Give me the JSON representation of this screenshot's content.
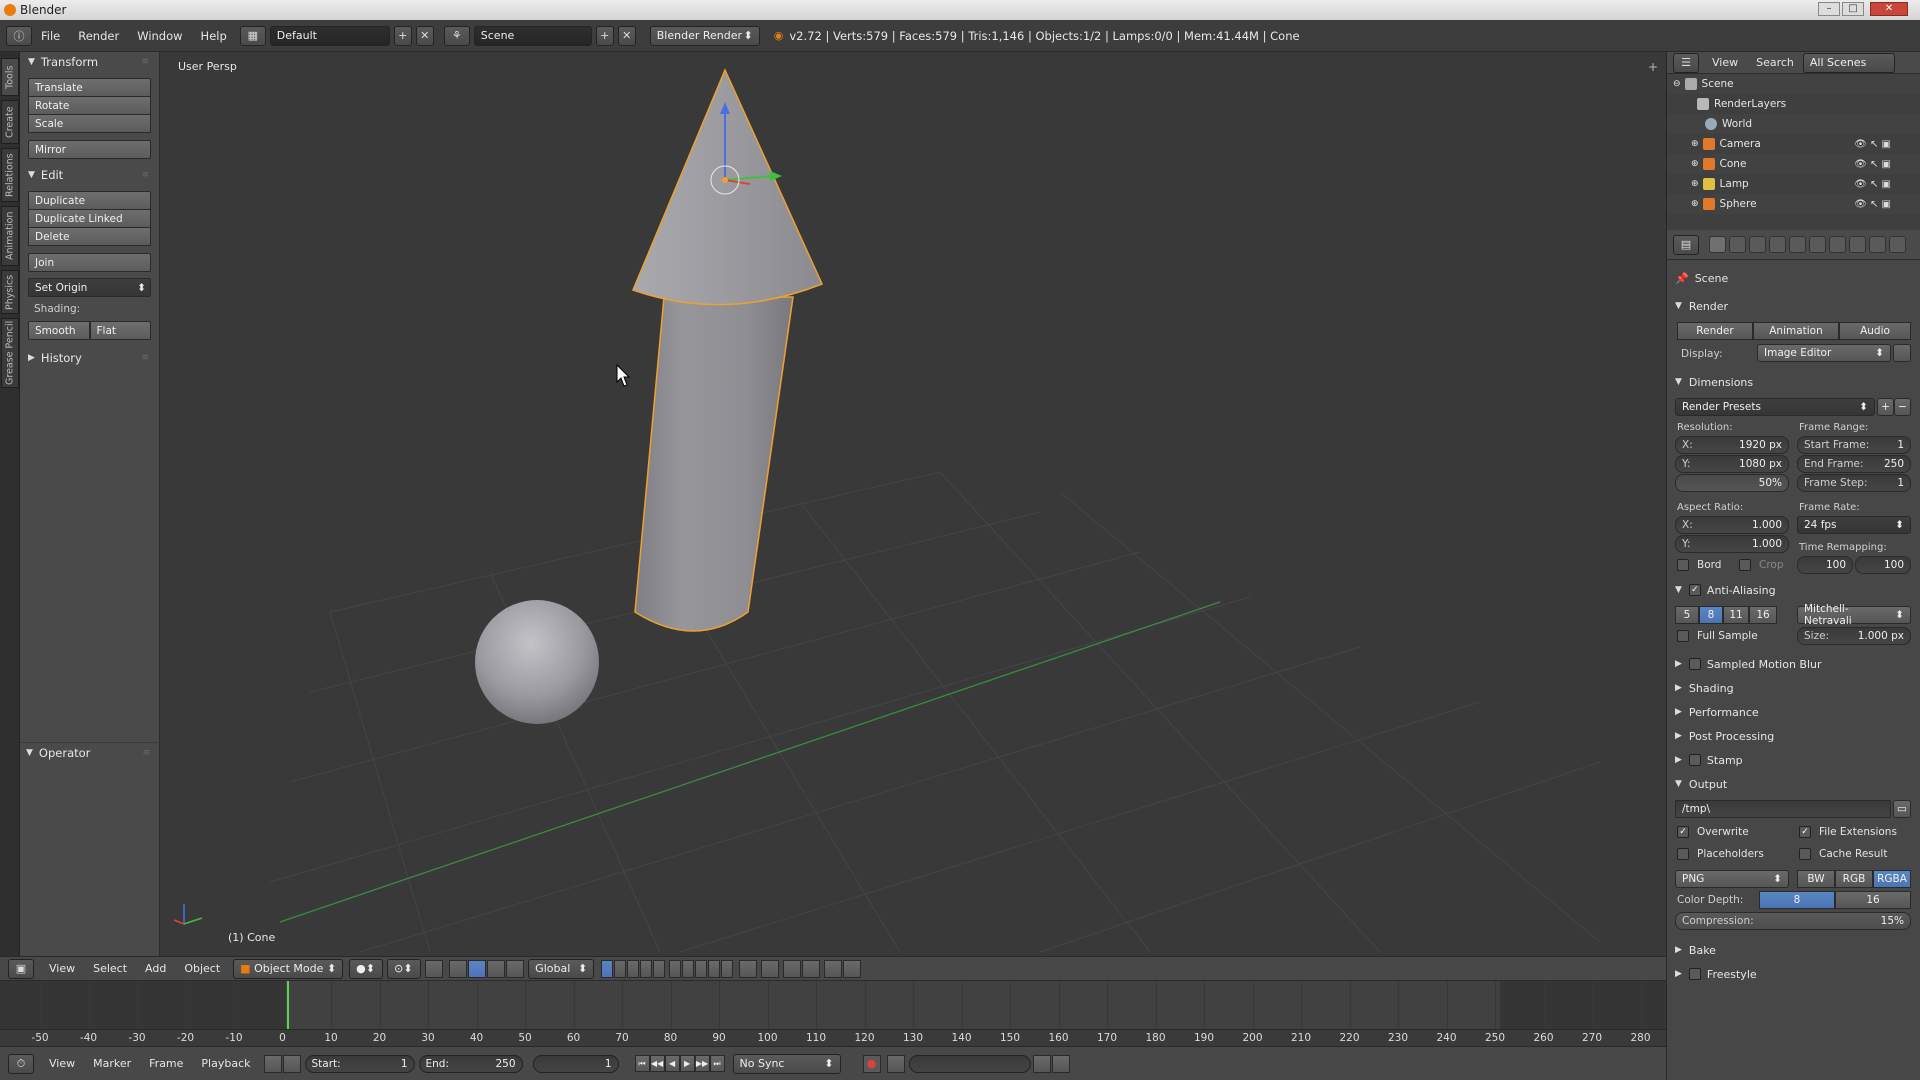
{
  "window": {
    "title": "Blender"
  },
  "topbar": {
    "menus": [
      "File",
      "Render",
      "Window",
      "Help"
    ],
    "layout": "Default",
    "scene": "Scene",
    "engine": "Blender Render",
    "stats": "v2.72 | Verts:579 | Faces:579 | Tris:1,146 | Objects:1/2 | Lamps:0/0 | Mem:41.44M | Cone"
  },
  "vtabs": [
    "Tools",
    "Create",
    "Relations",
    "Animation",
    "Physics",
    "Grease Pencil"
  ],
  "toolshelf": {
    "transform_title": "Transform",
    "translate": "Translate",
    "rotate": "Rotate",
    "scale": "Scale",
    "mirror": "Mirror",
    "edit_title": "Edit",
    "duplicate": "Duplicate",
    "duplicate_linked": "Duplicate Linked",
    "delete": "Delete",
    "join": "Join",
    "set_origin": "Set Origin",
    "shading_label": "Shading:",
    "smooth": "Smooth",
    "flat": "Flat",
    "history_title": "History",
    "operator_title": "Operator"
  },
  "viewport": {
    "label": "User Persp",
    "active_object": "(1) Cone"
  },
  "vpheader": {
    "menus": [
      "View",
      "Select",
      "Add",
      "Object"
    ],
    "mode": "Object Mode",
    "orientation": "Global"
  },
  "timeline": {
    "ticks": [
      "-50",
      "-40",
      "-30",
      "-20",
      "-10",
      "0",
      "10",
      "20",
      "30",
      "40",
      "50",
      "60",
      "70",
      "80",
      "90",
      "100",
      "110",
      "120",
      "130",
      "140",
      "150",
      "160",
      "170",
      "180",
      "190",
      "200",
      "210",
      "220",
      "230",
      "240",
      "250",
      "260",
      "270",
      "280"
    ],
    "current_frame": 1
  },
  "tlheader": {
    "menus": [
      "View",
      "Marker",
      "Frame",
      "Playback"
    ],
    "start": "Start:",
    "start_val": "1",
    "end": "End:",
    "end_val": "250",
    "current": "1",
    "sync": "No Sync"
  },
  "outliner": {
    "menus": [
      "View",
      "Search"
    ],
    "filter": "All Scenes",
    "items": [
      "Scene",
      "RenderLayers",
      "World",
      "Camera",
      "Cone",
      "Lamp",
      "Sphere"
    ]
  },
  "props": {
    "breadcrumb": "Scene",
    "render_title": "Render",
    "render_btn": "Render",
    "animation_btn": "Animation",
    "audio_btn": "Audio",
    "display_label": "Display:",
    "display_val": "Image Editor",
    "dimensions_title": "Dimensions",
    "presets": "Render Presets",
    "resolution_label": "Resolution:",
    "res_x_k": "X:",
    "res_x": "1920 px",
    "res_y_k": "Y:",
    "res_y": "1080 px",
    "res_pct": "50%",
    "frame_range_label": "Frame Range:",
    "start_frame_k": "Start Frame:",
    "start_frame": "1",
    "end_frame_k": "End Frame:",
    "end_frame": "250",
    "frame_step_k": "Frame Step:",
    "frame_step": "1",
    "aspect_label": "Aspect Ratio:",
    "asp_x_k": "X:",
    "asp_x": "1.000",
    "asp_y_k": "Y:",
    "asp_y": "1.000",
    "frame_rate_label": "Frame Rate:",
    "frame_rate": "24 fps",
    "time_remap_label": "Time Remapping:",
    "remap_old": "100",
    "remap_new": "100",
    "border": "Bord",
    "crop": "Crop",
    "aa_title": "Anti-Aliasing",
    "aa_5": "5",
    "aa_8": "8",
    "aa_11": "11",
    "aa_16": "16",
    "aa_filter": "Mitchell-Netravali",
    "full_sample": "Full Sample",
    "size_k": "Size:",
    "size": "1.000 px",
    "motion_blur": "Sampled Motion Blur",
    "shading": "Shading",
    "performance": "Performance",
    "post_processing": "Post Processing",
    "stamp": "Stamp",
    "output_title": "Output",
    "output_path": "/tmp\\",
    "overwrite": "Overwrite",
    "file_extensions": "File Extensions",
    "placeholders": "Placeholders",
    "cache_result": "Cache Result",
    "format": "PNG",
    "bw": "BW",
    "rgb": "RGB",
    "rgba": "RGBA",
    "color_depth_label": "Color Depth:",
    "depth_8": "8",
    "depth_16": "16",
    "compression_k": "Compression:",
    "compression": "15%",
    "bake": "Bake",
    "freestyle": "Freestyle"
  },
  "colors": {
    "selection": "#f0a030",
    "blue": "#5b86c4",
    "accent": "#e87d0d"
  }
}
